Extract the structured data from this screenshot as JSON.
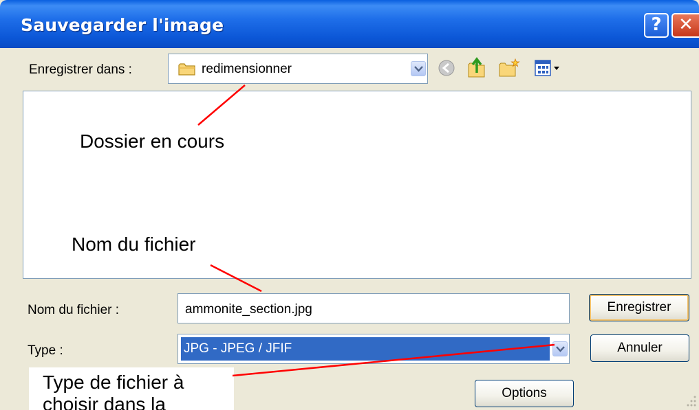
{
  "dialog": {
    "title": "Sauvegarder l'image",
    "help_label": "?",
    "close_label": "✕"
  },
  "save_in": {
    "label": "Enregistrer dans :",
    "value": "redimensionner"
  },
  "toolbar": {
    "icons": [
      "back-icon",
      "up-folder-icon",
      "new-folder-icon",
      "view-menu-icon"
    ]
  },
  "filename": {
    "label": "Nom du fichier :",
    "value": "ammonite_section.jpg"
  },
  "filetype": {
    "label": "Type :",
    "value": "JPG - JPEG / JFIF"
  },
  "buttons": {
    "save": "Enregistrer",
    "cancel": "Annuler",
    "options": "Options"
  },
  "annotations": {
    "current_folder": "Dossier en cours",
    "file_name": "Nom du fichier",
    "file_type_line1": "Type de fichier à",
    "file_type_line2": "choisir dans la"
  },
  "colors": {
    "titlebar": "#0b56d6",
    "dialog_bg": "#ece9d8",
    "selection": "#316ac5",
    "annotation_line": "#ff0000"
  }
}
